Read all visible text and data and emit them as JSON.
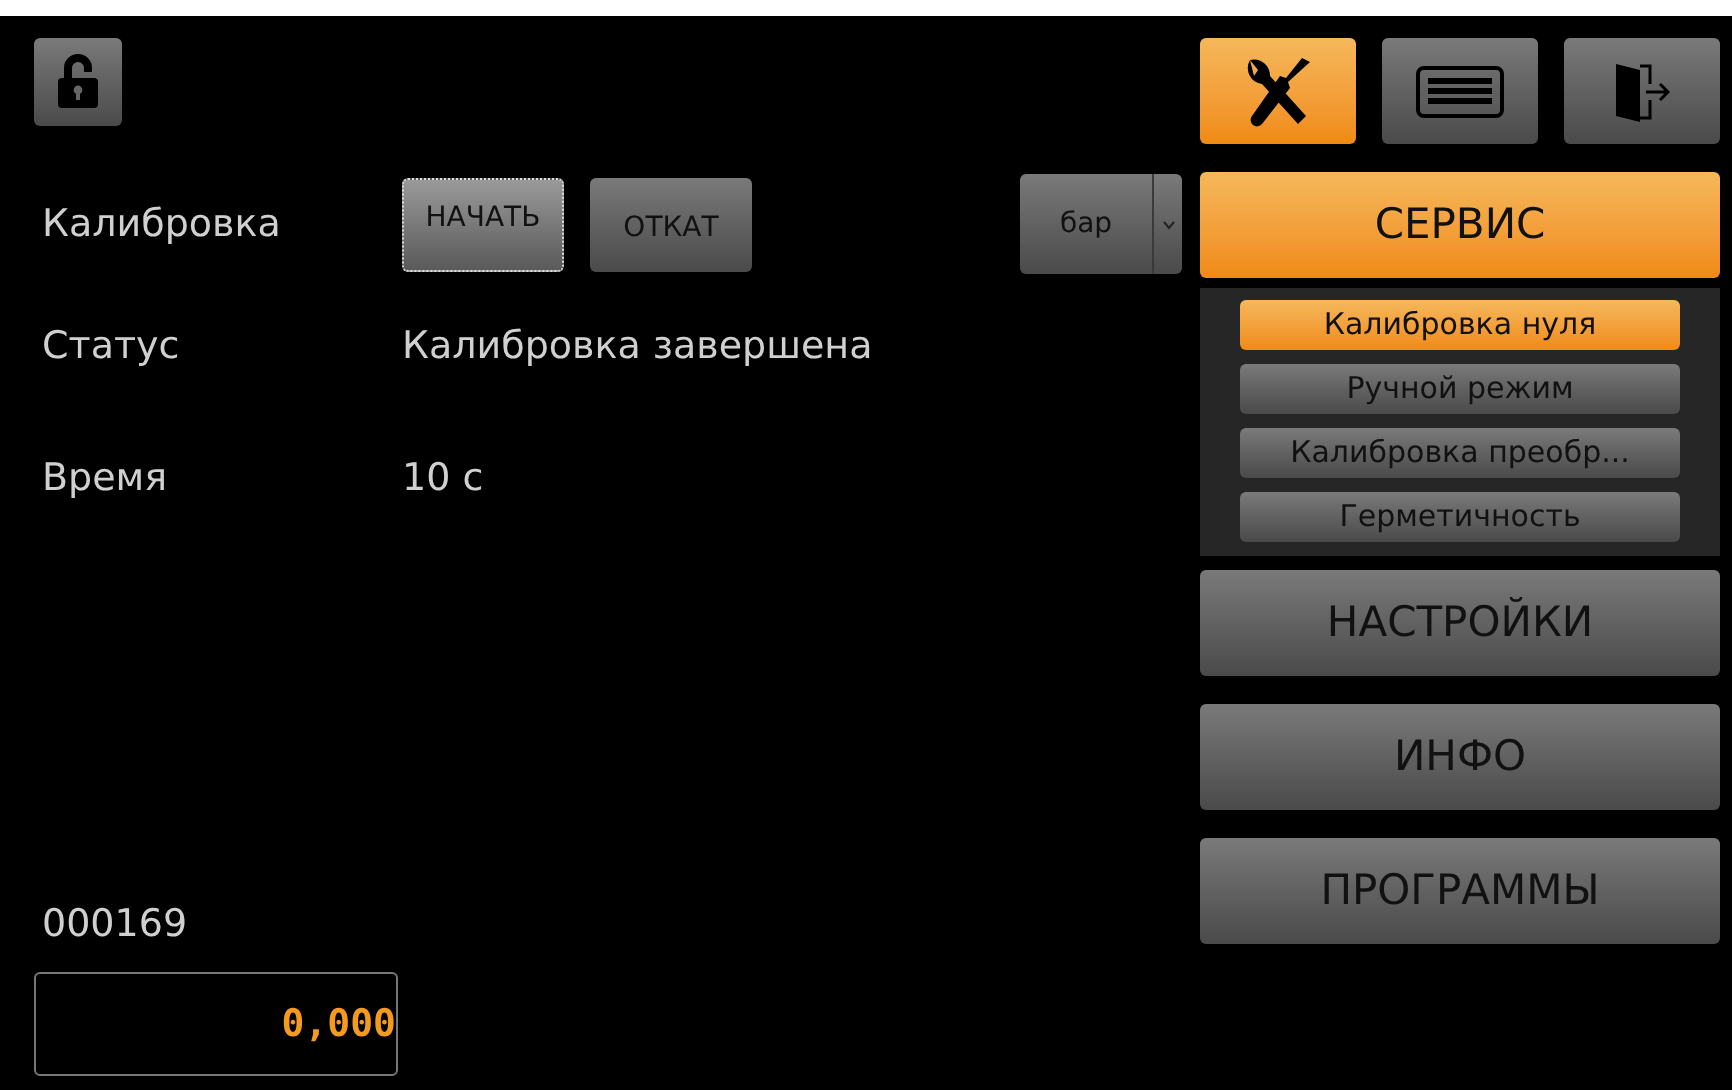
{
  "lock_button": {
    "kind": "lock"
  },
  "tool_buttons": [
    {
      "kind": "tools",
      "selected": true
    },
    {
      "kind": "keyboard",
      "selected": false
    },
    {
      "kind": "exit",
      "selected": false
    }
  ],
  "calibration": {
    "label": "Калибровка",
    "buttons": [
      {
        "label": "НАЧАТЬ",
        "focused": true
      },
      {
        "label": "ОТКАТ",
        "focused": false
      }
    ],
    "unit_dropdown": {
      "value": "бар"
    }
  },
  "fields": [
    {
      "label": "Статус",
      "value": "Калибровка завершена"
    },
    {
      "label": "Время",
      "value": "10 с"
    }
  ],
  "counter": "000169",
  "reading": "0,000",
  "menu": [
    {
      "label": "СЕРВИС",
      "selected": true,
      "children": [
        {
          "label": "Калибровка нуля",
          "selected": true
        },
        {
          "label": "Ручной режим",
          "selected": false
        },
        {
          "label": "Калибровка преобр...",
          "selected": false
        },
        {
          "label": "Герметичность",
          "selected": false
        }
      ]
    },
    {
      "label": "НАСТРОЙКИ",
      "selected": false
    },
    {
      "label": "ИНФО",
      "selected": false
    },
    {
      "label": "ПРОГРАММЫ",
      "selected": false
    }
  ]
}
